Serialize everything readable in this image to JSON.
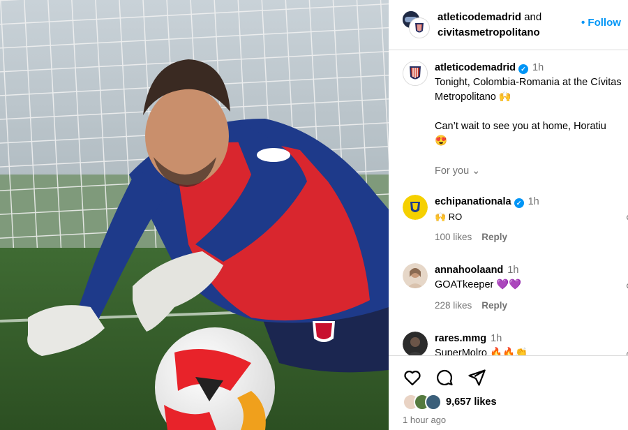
{
  "header": {
    "owner": "atleticodemadrid",
    "connector": " and",
    "collaborator": "civitasmetropolitano",
    "follow_label": "• Follow"
  },
  "post": {
    "username": "atleticodemadrid",
    "time": "1h",
    "caption": "Tonight, Colombia-Romania at the Cívitas Metropolitano 🙌\n\nCan’t wait to see you at home, Horatiu\n😍",
    "for_you_label": "For you ⌄"
  },
  "comments": [
    {
      "username": "echipanationala",
      "verified": true,
      "time": "1h",
      "text": "🙌 RO",
      "likes": "100 likes",
      "reply_label": "Reply"
    },
    {
      "username": "annahoolaand",
      "verified": false,
      "time": "1h",
      "text": "GOATkeeper 💜💜",
      "likes": "228 likes",
      "reply_label": "Reply"
    },
    {
      "username": "rares.mmg",
      "verified": false,
      "time": "1h",
      "text": "SuperMolro 🔥🔥👏",
      "likes": "",
      "reply_label": ""
    }
  ],
  "footer": {
    "likes_count": "9,657 likes",
    "time_ago": "1 hour ago"
  },
  "icons": {
    "like": "heart-icon",
    "comment": "comment-icon",
    "share": "share-icon"
  },
  "colors": {
    "accent": "#0095f6",
    "muted": "#737373",
    "jersey_red": "#d9262e",
    "jersey_blue": "#1e3a8a"
  }
}
